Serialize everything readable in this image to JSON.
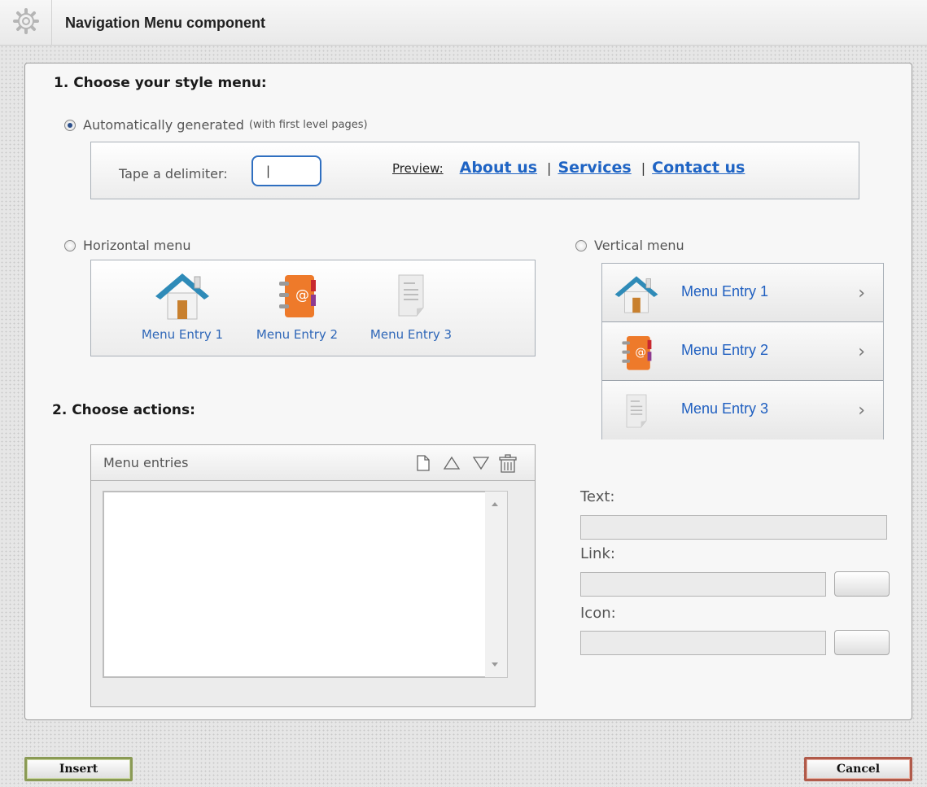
{
  "dialog": {
    "title": "Navigation Menu component"
  },
  "section1": {
    "heading": "1. Choose your style menu:",
    "auto": {
      "label": "Automatically generated",
      "hint": "(with first level pages)",
      "checked": true,
      "delimiter_label": "Tape a delimiter:",
      "delimiter_value": "|",
      "preview_label": "Preview:",
      "preview_links": [
        "About us",
        "Services",
        "Contact us"
      ],
      "separator": "|"
    },
    "horizontal": {
      "label": "Horizontal menu",
      "checked": false,
      "entries": [
        {
          "label": "Menu Entry 1",
          "icon": "home-icon"
        },
        {
          "label": "Menu Entry 2",
          "icon": "address-book-icon"
        },
        {
          "label": "Menu Entry 3",
          "icon": "document-icon"
        }
      ]
    },
    "vertical": {
      "label": "Vertical menu",
      "checked": false,
      "entries": [
        {
          "label": "Menu Entry 1",
          "icon": "home-icon"
        },
        {
          "label": "Menu Entry 2",
          "icon": "address-book-icon"
        },
        {
          "label": "Menu Entry 3",
          "icon": "document-icon"
        }
      ]
    }
  },
  "section2": {
    "heading": "2. Choose actions:",
    "entries_title": "Menu entries",
    "tools": [
      "new-document-icon",
      "move-up-icon",
      "move-down-icon",
      "trash-icon"
    ],
    "text_label": "Text:",
    "text_value": "",
    "link_label": "Link:",
    "link_value": "",
    "icon_label": "Icon:",
    "icon_value": ""
  },
  "footer": {
    "insert_label": "Insert",
    "cancel_label": "Cancel"
  },
  "colors": {
    "link_blue": "#1f64c4",
    "insert_border": "#8a9a55",
    "cancel_border": "#b05a4a"
  }
}
